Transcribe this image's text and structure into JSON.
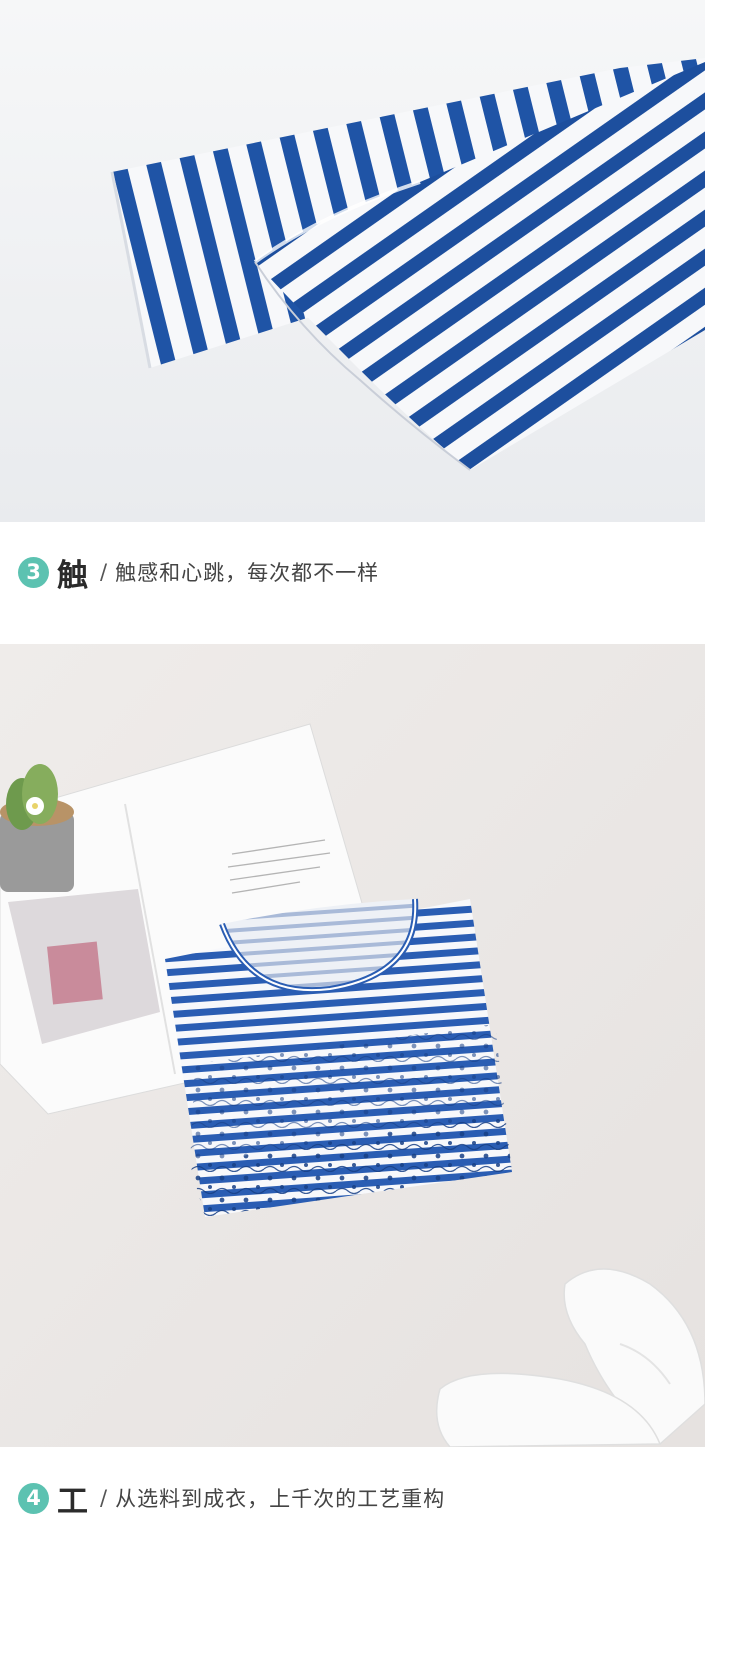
{
  "sections": [
    {
      "number": "3",
      "title": "触",
      "separator": "/",
      "caption": "触感和心跳，每次都不一样",
      "photo": "striped-sleeve-cuff-closeup"
    },
    {
      "number": "4",
      "title": "工",
      "separator": "/",
      "caption": "从选料到成衣，上千次的工艺重构",
      "photo": "folded-striped-tshirt-flatlay"
    }
  ],
  "colors": {
    "accent": "#5cc2b1",
    "stripe_blue": "#1f54a6",
    "background_top": "#f1f2f4",
    "background_bottom": "#ebe8e7"
  }
}
